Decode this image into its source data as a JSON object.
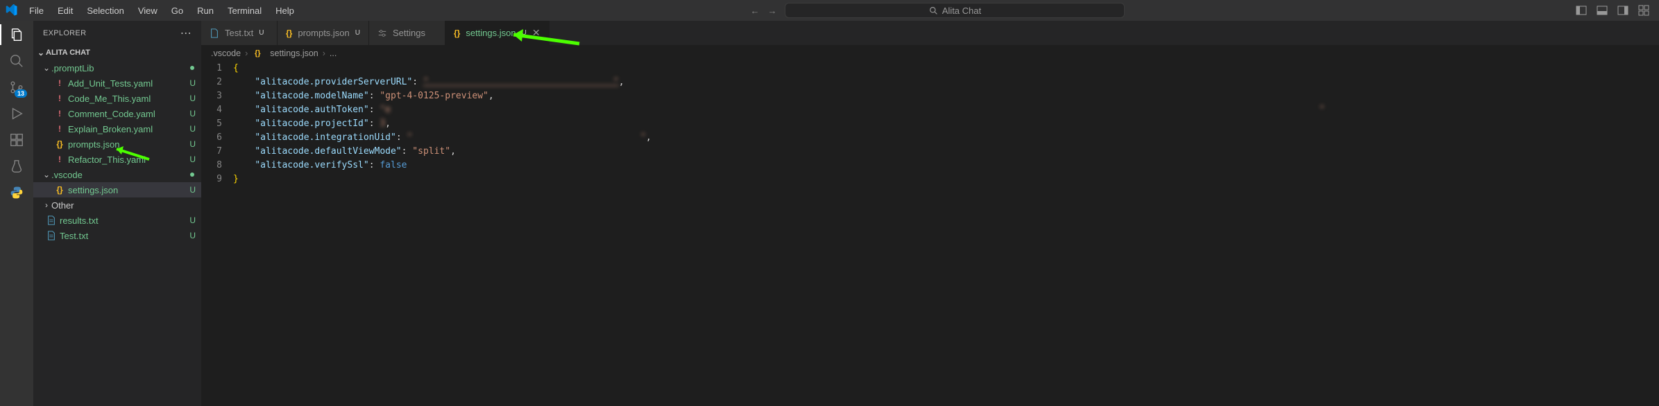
{
  "menubar": {
    "items": [
      "File",
      "Edit",
      "Selection",
      "View",
      "Go",
      "Run",
      "Terminal",
      "Help"
    ]
  },
  "search_placeholder": "Alita Chat",
  "sidebar": {
    "title": "EXPLORER",
    "root": "ALITA CHAT",
    "folders": {
      "promptLib": ".promptLib",
      "vscode": ".vscode",
      "other": "Other"
    },
    "files": {
      "add_unit": "Add_Unit_Tests.yaml",
      "code_me": "Code_Me_This.yaml",
      "comment": "Comment_Code.yaml",
      "explain": "Explain_Broken.yaml",
      "prompts": "prompts.json",
      "refactor": "Refactor_This.yaml",
      "settings": "settings.json",
      "results": "results.txt",
      "test": "Test.txt"
    }
  },
  "tabs": {
    "t0": {
      "label": "Test.txt",
      "mod": "U"
    },
    "t1": {
      "label": "prompts.json",
      "mod": "U"
    },
    "t2": {
      "label": "Settings"
    },
    "t3": {
      "label": "settings.json",
      "mod": "U"
    }
  },
  "breadcrumb": {
    "b0": ".vscode",
    "b1": "settings.json",
    "b2": "..."
  },
  "code": {
    "open": "{",
    "k1": "\"alitacode.providerServerURL\"",
    "v1": "\"                                  \"",
    "k2": "\"alitacode.modelName\"",
    "v2": "\"gpt-4-0125-preview\"",
    "k3": "\"alitacode.authToken\"",
    "v3": "\"e                                                                                                                                                                           \"",
    "k4": "\"alitacode.projectId\"",
    "v4": "3",
    "k5": "\"alitacode.integrationUid\"",
    "v5": "\"                                          \"",
    "k6": "\"alitacode.defaultViewMode\"",
    "v6": "\"split\"",
    "k7": "\"alitacode.verifySsl\"",
    "v7": "false",
    "close": "}"
  },
  "scm_badge": "13"
}
